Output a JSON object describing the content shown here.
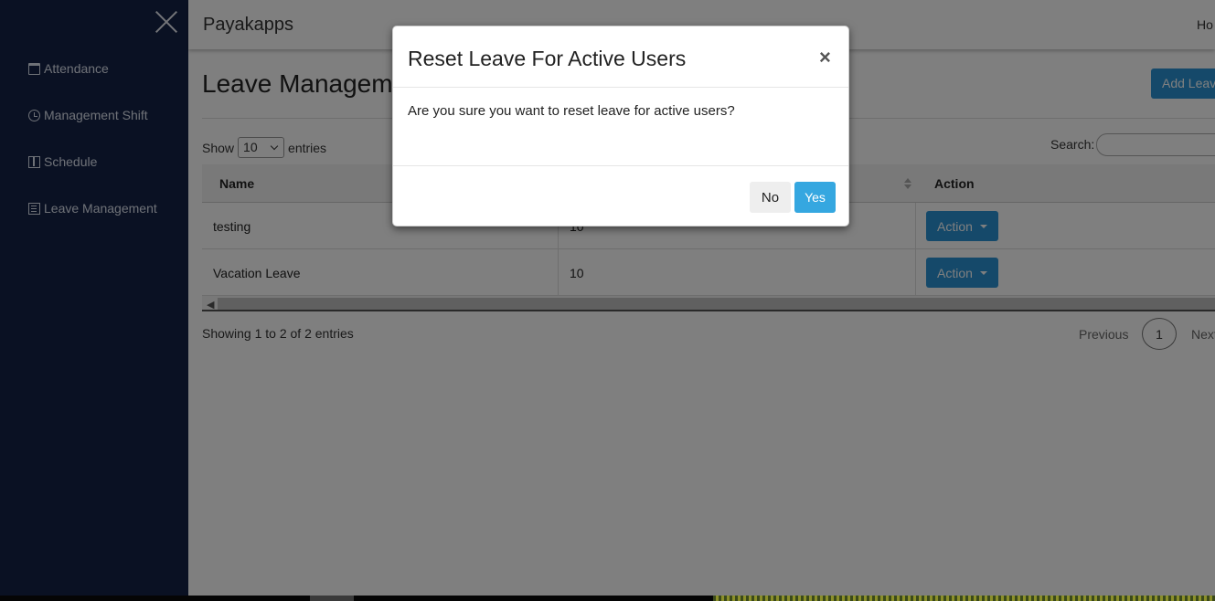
{
  "sidebar": {
    "items": [
      {
        "label": "Attendance",
        "icon": "calendar-icon"
      },
      {
        "label": "Management Shift",
        "icon": "clock-icon"
      },
      {
        "label": "Schedule",
        "icon": "book-icon"
      },
      {
        "label": "Leave Management",
        "icon": "document-icon"
      }
    ]
  },
  "header": {
    "brand": "Payakapps",
    "right_link": "Ho"
  },
  "page": {
    "title": "Leave Manageme",
    "add_button": "Add Leav"
  },
  "table_controls": {
    "show_label": "Show",
    "entries_value": "10",
    "entries_label": "entries",
    "search_label": "Search:",
    "search_value": ""
  },
  "table": {
    "columns": [
      "Name",
      "Action"
    ],
    "rows": [
      {
        "name": "testing",
        "value": "10",
        "action": "Action"
      },
      {
        "name": "Vacation Leave",
        "value": "10",
        "action": "Action"
      }
    ]
  },
  "footer": {
    "info": "Showing 1 to 2 of 2 entries",
    "previous": "Previous",
    "page": "1",
    "next": "Next"
  },
  "modal": {
    "title": "Reset Leave For Active Users",
    "close": "×",
    "body": "Are you sure you want to reset leave for active users?",
    "no_label": "No",
    "yes_label": "Yes"
  },
  "colors": {
    "sidebar_bg": "#152347",
    "primary": "#2a93d5",
    "yes_button": "#35a7e0"
  }
}
